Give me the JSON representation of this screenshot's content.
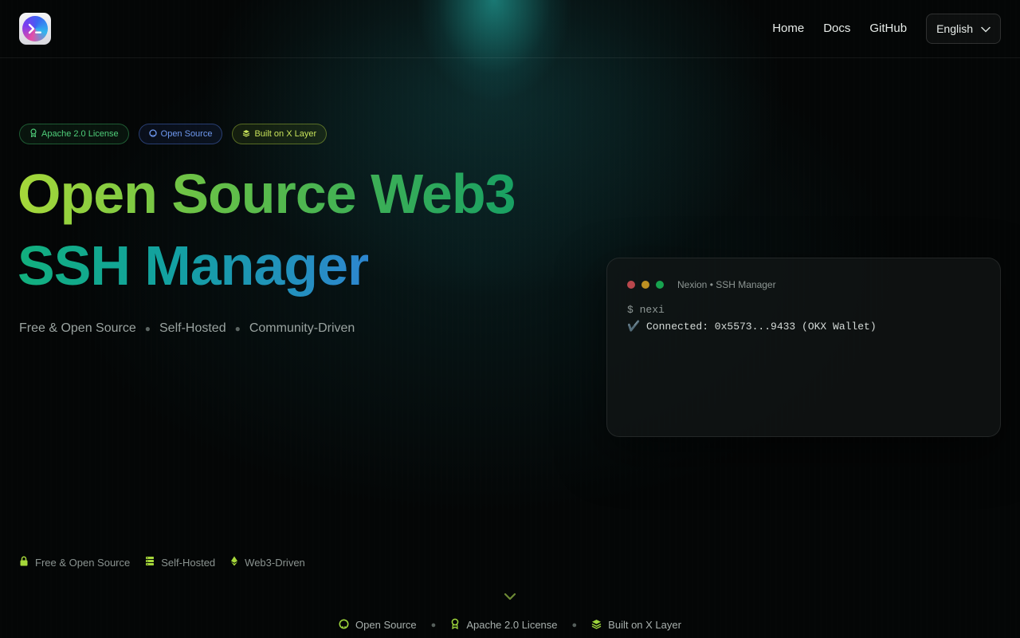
{
  "header": {
    "logo_icon": "terminal-prompt-icon",
    "nav": [
      "Home",
      "Docs",
      "GitHub"
    ],
    "language": "English"
  },
  "badges": [
    {
      "label": "Apache 2.0 License",
      "icon": "award-icon",
      "color": "#4fce7a"
    },
    {
      "label": "Open Source",
      "icon": "github-icon",
      "color": "#6f99f0"
    },
    {
      "label": "Built on X Layer",
      "icon": "layers-icon",
      "color": "#c7e25a"
    }
  ],
  "hero": {
    "title_line1": "Open Source Web3",
    "title_line2": "SSH Manager",
    "tagline": [
      "Free & Open Source",
      "Self-Hosted",
      "Community-Driven"
    ]
  },
  "terminal": {
    "title": "Nexion • SSH Manager",
    "lines": [
      "$ nexi",
      "✔️ Connected: 0x5573...9433 (OKX Wallet)"
    ]
  },
  "features": [
    {
      "label": "Free & Open Source",
      "icon": "lock-icon"
    },
    {
      "label": "Self-Hosted",
      "icon": "server-icon"
    },
    {
      "label": "Web3-Driven",
      "icon": "ethereum-icon"
    }
  ],
  "footer": [
    {
      "label": "Open Source",
      "icon": "github-icon"
    },
    {
      "label": "Apache 2.0 License",
      "icon": "award-icon"
    },
    {
      "label": "Built on X Layer",
      "icon": "layers-icon"
    }
  ],
  "colors": {
    "accent_green": "#9ed63c",
    "accent_teal": "#13a0a2",
    "accent_blue": "#2d86cf",
    "background": "#040606"
  }
}
